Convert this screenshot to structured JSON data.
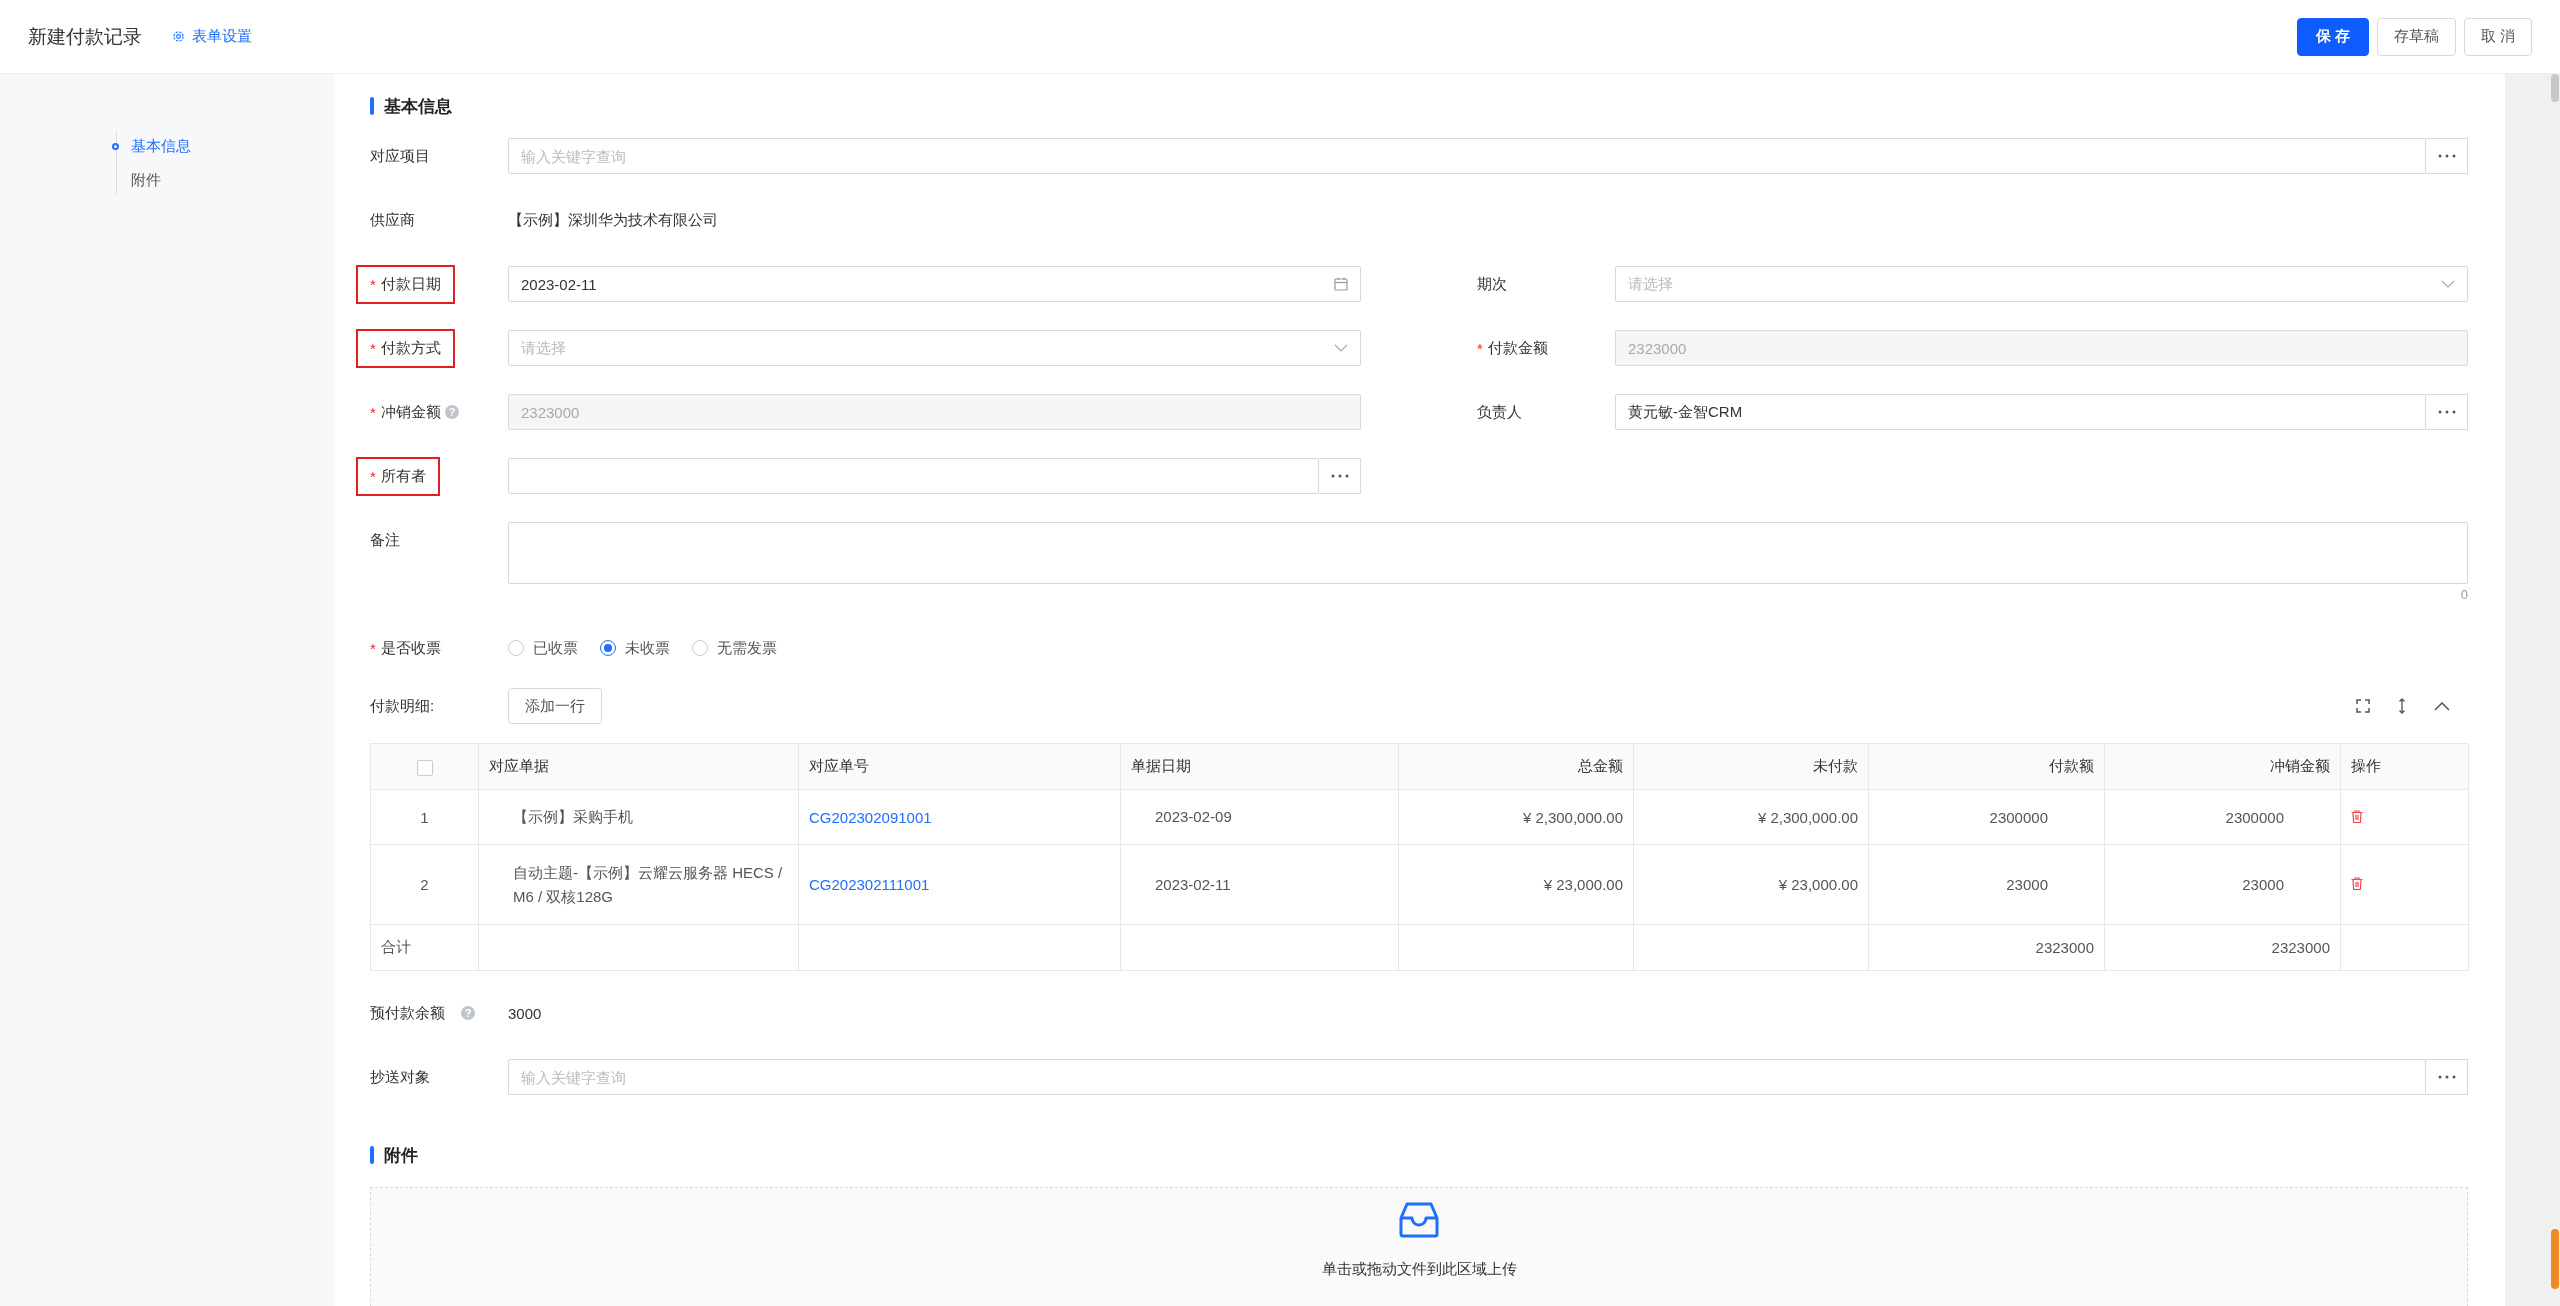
{
  "header": {
    "title": "新建付款记录",
    "settings_link": "表单设置",
    "buttons": [
      {
        "label": "保 存",
        "kind": "primary"
      },
      {
        "label": "存草稿",
        "kind": "default"
      },
      {
        "label": "取 消",
        "kind": "default"
      }
    ]
  },
  "sidebar": {
    "items": [
      {
        "label": "基本信息",
        "selected": true
      },
      {
        "label": "附件",
        "selected": false
      }
    ]
  },
  "basic_info": {
    "title": "基本信息",
    "fields": [
      {
        "kind": "search",
        "label": "对应项目",
        "highlighted": false,
        "placeholder": "输入关键字查询"
      },
      {
        "kind": "text",
        "label": "供应商",
        "highlighted": false,
        "value": "【示例】深圳华为技术有限公司"
      },
      {
        "kind": "date",
        "label": "付款日期",
        "required_mark": "*",
        "highlighted": true,
        "value": "2023-02-11"
      },
      {
        "kind": "select",
        "label": "期次",
        "highlighted": false,
        "placeholder": "请选择"
      },
      {
        "kind": "select",
        "label": "付款方式",
        "required_mark": "*",
        "highlighted": true,
        "placeholder": "请选择"
      },
      {
        "kind": "disabled",
        "label": "付款金额",
        "required_mark": "*",
        "highlighted": false,
        "value": "2323000"
      },
      {
        "kind": "disabled",
        "label": "冲销金额",
        "required_mark": "*",
        "highlighted": false,
        "help_icon": "?",
        "value": "2323000"
      },
      {
        "kind": "picker",
        "label": "负责人",
        "highlighted": false,
        "value": "黄元敏-金智CRM"
      },
      {
        "kind": "picker",
        "label": "所有者",
        "required_mark": "*",
        "highlighted": true
      },
      {
        "kind": "textarea",
        "label": "备注",
        "highlighted": false,
        "counter": "0"
      },
      {
        "kind": "radio",
        "label": "是否收票",
        "required_mark": "*",
        "highlighted": false,
        "options": [
          {
            "label": "已收票",
            "selected": false
          },
          {
            "label": "未收票",
            "selected": true
          },
          {
            "label": "无需发票",
            "selected": false
          }
        ]
      }
    ]
  },
  "payment_details": {
    "label": "付款明细:",
    "add_button": "添加一行",
    "table": {
      "select_all_checked": false,
      "columns": [
        "对应单据",
        "对应单号",
        "单据日期",
        "总金额",
        "未付款",
        "付款额",
        "冲销金额",
        "操作"
      ],
      "rows": [
        {
          "index": "1",
          "document": "【示例】采购手机",
          "number": "CG202302091001",
          "date": "2023-02-09",
          "total": "¥ 2,300,000.00",
          "unpaid": "¥ 2,300,000.00",
          "paid": "2300000",
          "write_off": "2300000"
        },
        {
          "index": "2",
          "document": "自动主题-【示例】云耀云服务器 HECS / M6 / 双核128G",
          "number": "CG202302111001",
          "date": "2023-02-11",
          "total": "¥ 23,000.00",
          "unpaid": "¥ 23,000.00",
          "paid": "23000",
          "write_off": "23000"
        }
      ],
      "summary": {
        "label": "合计",
        "paid": "2323000",
        "write_off": "2323000"
      }
    }
  },
  "prepaid_balance": {
    "label": "预付款余额",
    "help_icon": "?",
    "value": "3000"
  },
  "cc": {
    "label": "抄送对象",
    "placeholder": "输入关键字查询"
  },
  "attachments": {
    "title": "附件",
    "upload_text": "单击或拖动文件到此区域上传"
  }
}
